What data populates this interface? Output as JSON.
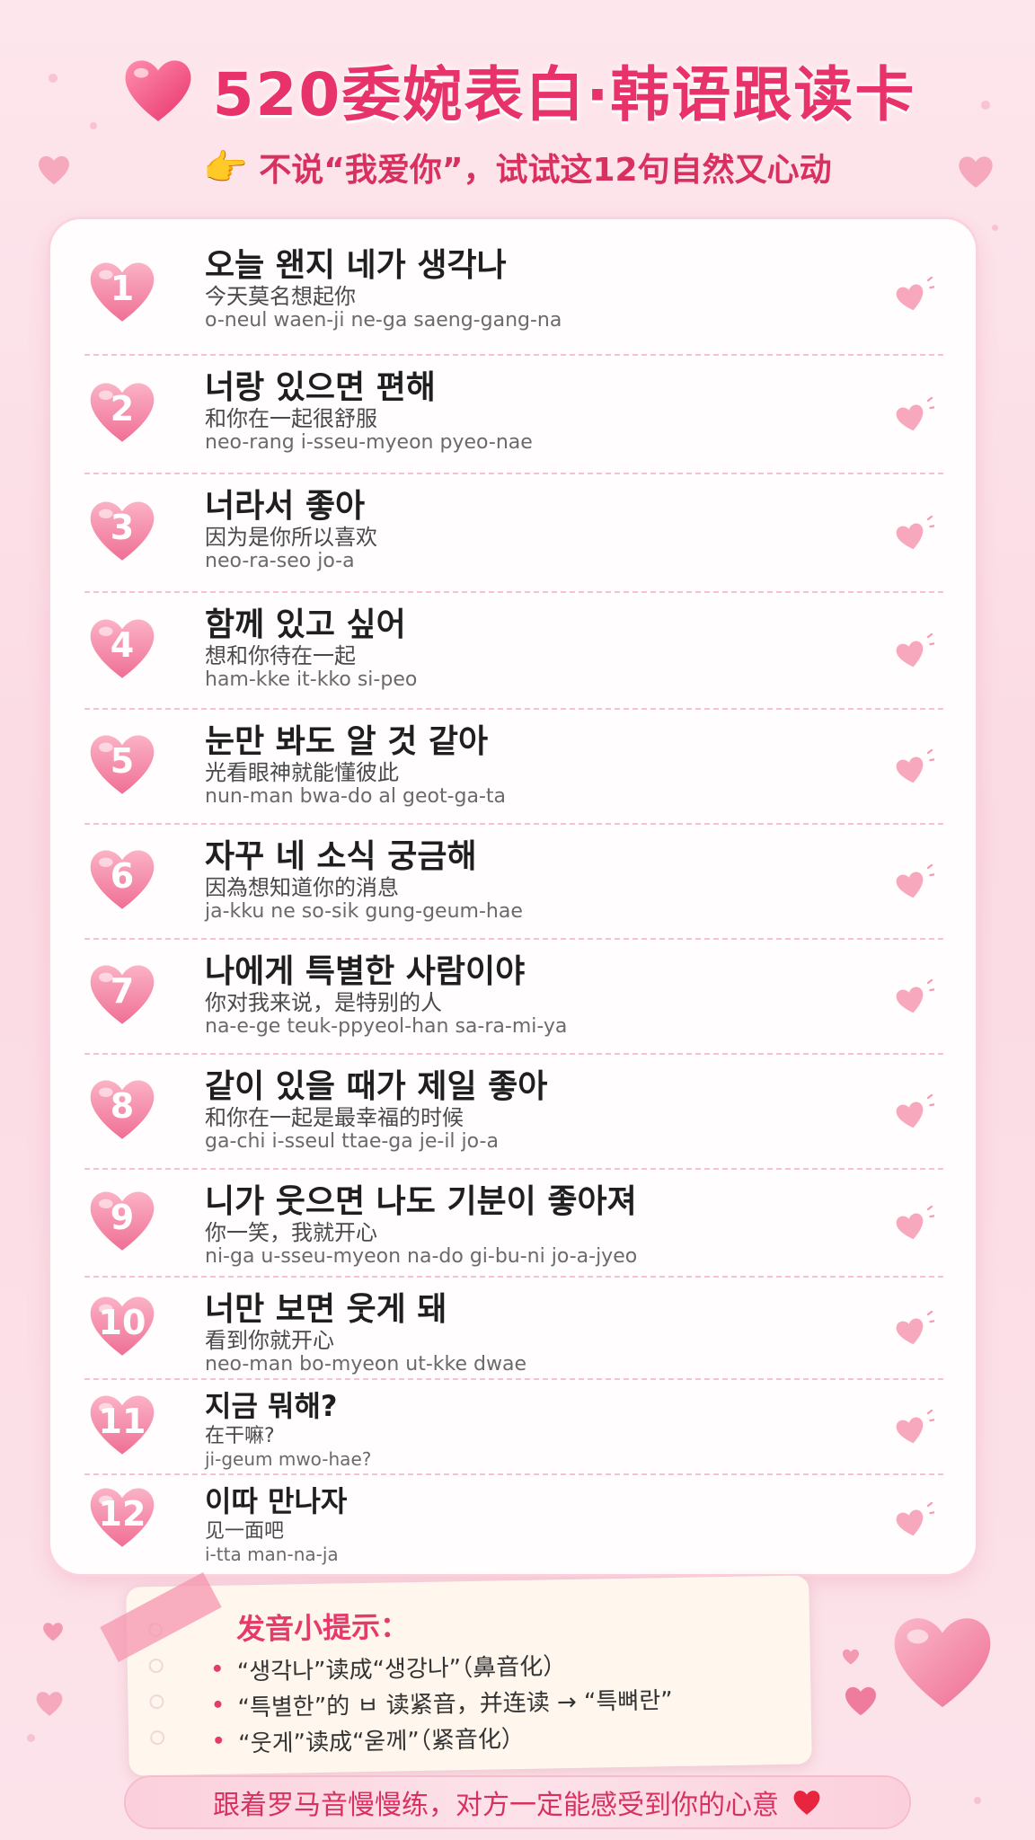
{
  "header": {
    "title": "520委婉表白·韩语跟读卡",
    "subtitle": "不说“我爱你”，试试这12句自然又心动",
    "title_icon": "heart-icon",
    "subtitle_icon": "pointing-hand-icon"
  },
  "colors": {
    "accent": "#e8336a",
    "heart": "#f47ca0",
    "background": "#fde6ec"
  },
  "phrases": [
    {
      "num": "1",
      "korean": "오늘 왠지 네가 생각나",
      "chinese": "今天莫名想起你",
      "roman": "o-neul waen-ji ne-ga saeng-gang-na"
    },
    {
      "num": "2",
      "korean": "너랑 있으면 편해",
      "chinese": "和你在一起很舒服",
      "roman": "neo-rang i-sseu-myeon pyeo-nae"
    },
    {
      "num": "3",
      "korean": "너라서 좋아",
      "chinese": "因为是你所以喜欢",
      "roman": "neo-ra-seo jo-a"
    },
    {
      "num": "4",
      "korean": "함께 있고 싶어",
      "chinese": "想和你待在一起",
      "roman": "ham-kke it-kko si-peo"
    },
    {
      "num": "5",
      "korean": "눈만 봐도 알 것 같아",
      "chinese": "光看眼神就能懂彼此",
      "roman": "nun-man bwa-do al geot-ga-ta"
    },
    {
      "num": "6",
      "korean": "자꾸 네 소식 궁금해",
      "chinese": "因為想知道你的消息",
      "roman": "ja-kku ne so-sik gung-geum-hae"
    },
    {
      "num": "7",
      "korean": "나에게 특별한 사람이야",
      "chinese": "你对我来说，是特别的人",
      "roman": "na-e-ge teuk-ppyeol-han sa-ra-mi-ya"
    },
    {
      "num": "8",
      "korean": "같이 있을 때가 제일 좋아",
      "chinese": "和你在一起是最幸福的时候",
      "roman": "ga-chi i-sseul ttae-ga je-il jo-a"
    },
    {
      "num": "9",
      "korean": "니가 웃으면 나도 기분이 좋아져",
      "chinese": "你一笑，我就开心",
      "roman": "ni-ga u-sseu-myeon na-do gi-bu-ni jo-a-jyeo"
    },
    {
      "num": "10",
      "korean": "너만 보면 웃게 돼",
      "chinese": "看到你就开心",
      "roman": "neo-man bo-myeon ut-kke dwae"
    },
    {
      "num": "11",
      "korean": "지금 뭐해?",
      "chinese": "在干嘛?",
      "roman": "ji-geum mwo-hae?"
    },
    {
      "num": "12",
      "korean": "이따 만나자",
      "chinese": "见一面吧",
      "roman": "i-tta man-na-ja"
    }
  ],
  "tips": {
    "title": "发音小提示：",
    "items": [
      "“생각나”读成“생강나”（鼻音化）",
      "“특별한”的 ㅂ 读紧音，并连读 → “특뼈란”",
      "“웃게”读成“욷께”（紧音化）"
    ]
  },
  "footer": {
    "text": "跟着罗马音慢慢练，对方一定能感受到你的心意",
    "icon": "heart-icon"
  }
}
